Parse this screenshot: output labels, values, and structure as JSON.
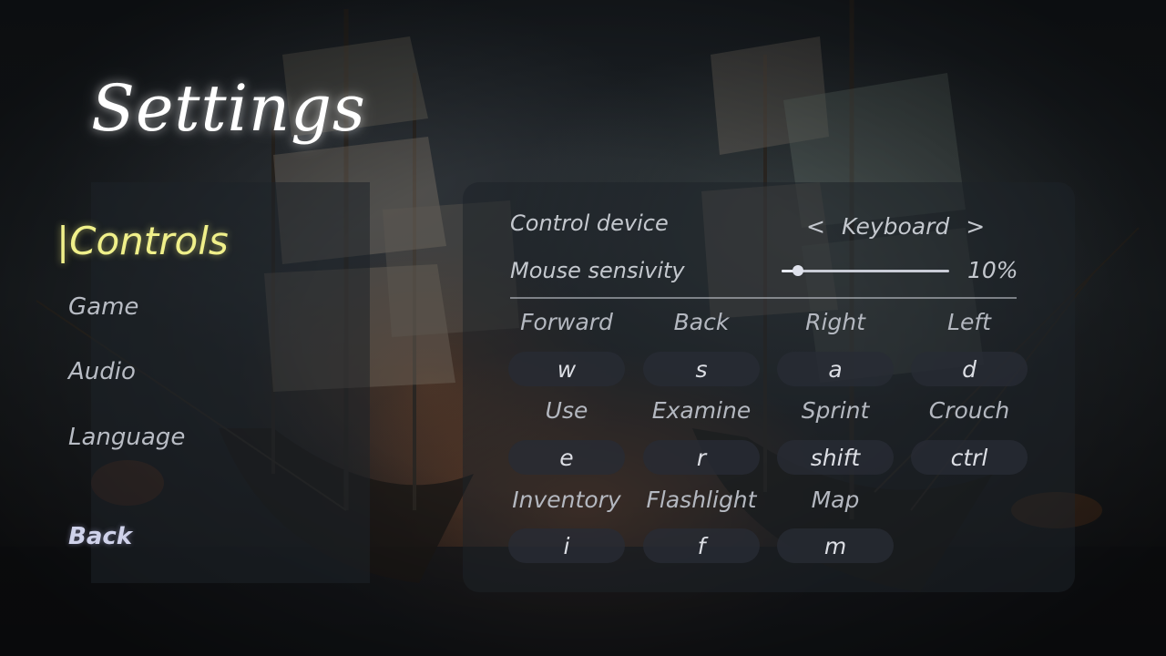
{
  "title": "Settings",
  "menu": {
    "items": [
      {
        "label": "|Controls",
        "active": true
      },
      {
        "label": "Game",
        "active": false
      },
      {
        "label": "Audio",
        "active": false
      },
      {
        "label": "Language",
        "active": false
      }
    ],
    "back_label": "Back"
  },
  "controls": {
    "device": {
      "label": "Control device",
      "value": "Keyboard",
      "prev_icon": "<",
      "next_icon": ">"
    },
    "sensitivity": {
      "label": "Mouse sensivity",
      "value": 10,
      "value_text": "10%"
    },
    "bindings": [
      {
        "action": "Forward",
        "key": "w"
      },
      {
        "action": "Back",
        "key": "s"
      },
      {
        "action": "Right",
        "key": "a"
      },
      {
        "action": "Left",
        "key": "d"
      },
      {
        "action": "Use",
        "key": "e"
      },
      {
        "action": "Examine",
        "key": "r"
      },
      {
        "action": "Sprint",
        "key": "shift"
      },
      {
        "action": "Crouch",
        "key": "ctrl"
      },
      {
        "action": "Inventory",
        "key": "i"
      },
      {
        "action": "Flashlight",
        "key": "f"
      },
      {
        "action": "Map",
        "key": "m"
      }
    ]
  },
  "colors": {
    "active_menu": "#f0f08a",
    "text": "#c4c8ce",
    "panel": "rgba(30,34,40,0.55)"
  }
}
